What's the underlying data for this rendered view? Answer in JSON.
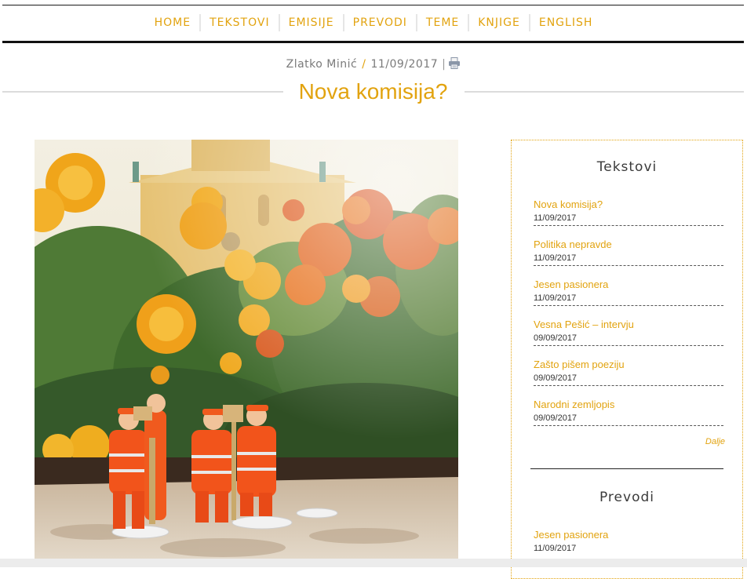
{
  "nav": {
    "items": [
      {
        "label": "HOME"
      },
      {
        "label": "TEKSTOVI"
      },
      {
        "label": "EMISIJE"
      },
      {
        "label": "PREVODI"
      },
      {
        "label": "TEME"
      },
      {
        "label": "KNJIGE"
      },
      {
        "label": "ENGLISH"
      }
    ]
  },
  "article": {
    "author": "Zlatko Minić",
    "slash": "/",
    "date": "11/09/2017",
    "separator": "|",
    "title": "Nova komisija?"
  },
  "sidebar": {
    "tekstovi": {
      "heading": "Tekstovi",
      "items": [
        {
          "title": "Nova komisija?",
          "date": "11/09/2017"
        },
        {
          "title": "Politika nepravde",
          "date": "11/09/2017"
        },
        {
          "title": "Jesen pasionera",
          "date": "11/09/2017"
        },
        {
          "title": "Vesna Pešić – intervju",
          "date": "09/09/2017"
        },
        {
          "title": "Zašto pišem poeziju",
          "date": "09/09/2017"
        },
        {
          "title": "Narodni zemljopis",
          "date": "09/09/2017"
        }
      ],
      "more": "Dalje"
    },
    "prevodi": {
      "heading": "Prevodi",
      "items": [
        {
          "title": "Jesen pasionera",
          "date": "11/09/2017"
        }
      ]
    }
  },
  "colors": {
    "accent": "#e2a30f",
    "rule": "#111111"
  }
}
